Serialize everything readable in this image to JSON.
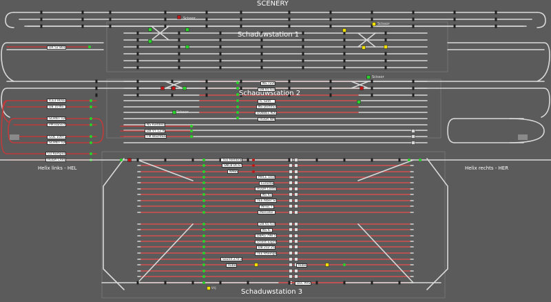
{
  "colors": {
    "background": "#5b5b5b",
    "track": "#d9d9d9",
    "track_occupied": "#c03b3b",
    "signal_green": "#28d228",
    "signal_red": "#c01818",
    "signal_yellow": "#f2e000",
    "block_marker": "#1e1e1e"
  },
  "titles": {
    "scenery": "SCENERY",
    "station1": "Schaduwstation 1",
    "station2": "Schaduwstation 2",
    "station3": "Schaduwstation 3",
    "helix_left": "Helix links - HEL",
    "helix_right": "Helix rechts - HER"
  },
  "scissors": {
    "s1": "Scissor",
    "s2": "Scissor",
    "s3": "Scissor",
    "s4": "Scissor"
  },
  "left_trains": [
    "DR 52 801",
    "ICE3 HOLE",
    "DB 10 NS",
    "SCHN FTDR",
    "PM Hansch",
    "GOE 1097Z",
    "SCHN FTDR",
    "CD Kompozes",
    "HUDA CARGO"
  ],
  "station2_trains": [
    "NS 7226",
    "DB 65 618",
    "IC Sintl",
    "NS Dortmund",
    "DUBBEL KOUPPE",
    "HUDA NMS"
  ],
  "station2_lower_trains": [
    "NS Rietdekap",
    "DB VT 12 9",
    "FM Wachtkeeld"
  ],
  "station3_upper_trains": [
    "TEE Rembrandt",
    "SNCB DCS711",
    "NMBS"
  ],
  "station3_middle_trains": [
    "MRCE 1016",
    "Eurostar",
    "HUDA Container",
    "NS ICE",
    "TEE Alber Schew",
    "INTEL T",
    "Mercator"
  ],
  "station3_lower_trains": [
    "DB 65 618",
    "NS IC",
    "DBAG 798 591 T",
    "Orient Express",
    "DB 212 259 6",
    "TEE Rheingold"
  ],
  "station3_bottom": {
    "t1": "Sound 270-2 RB",
    "t2": "Ruber",
    "t3": "Ruber",
    "t4": "DLC PRSS",
    "legend": "Vrij"
  }
}
